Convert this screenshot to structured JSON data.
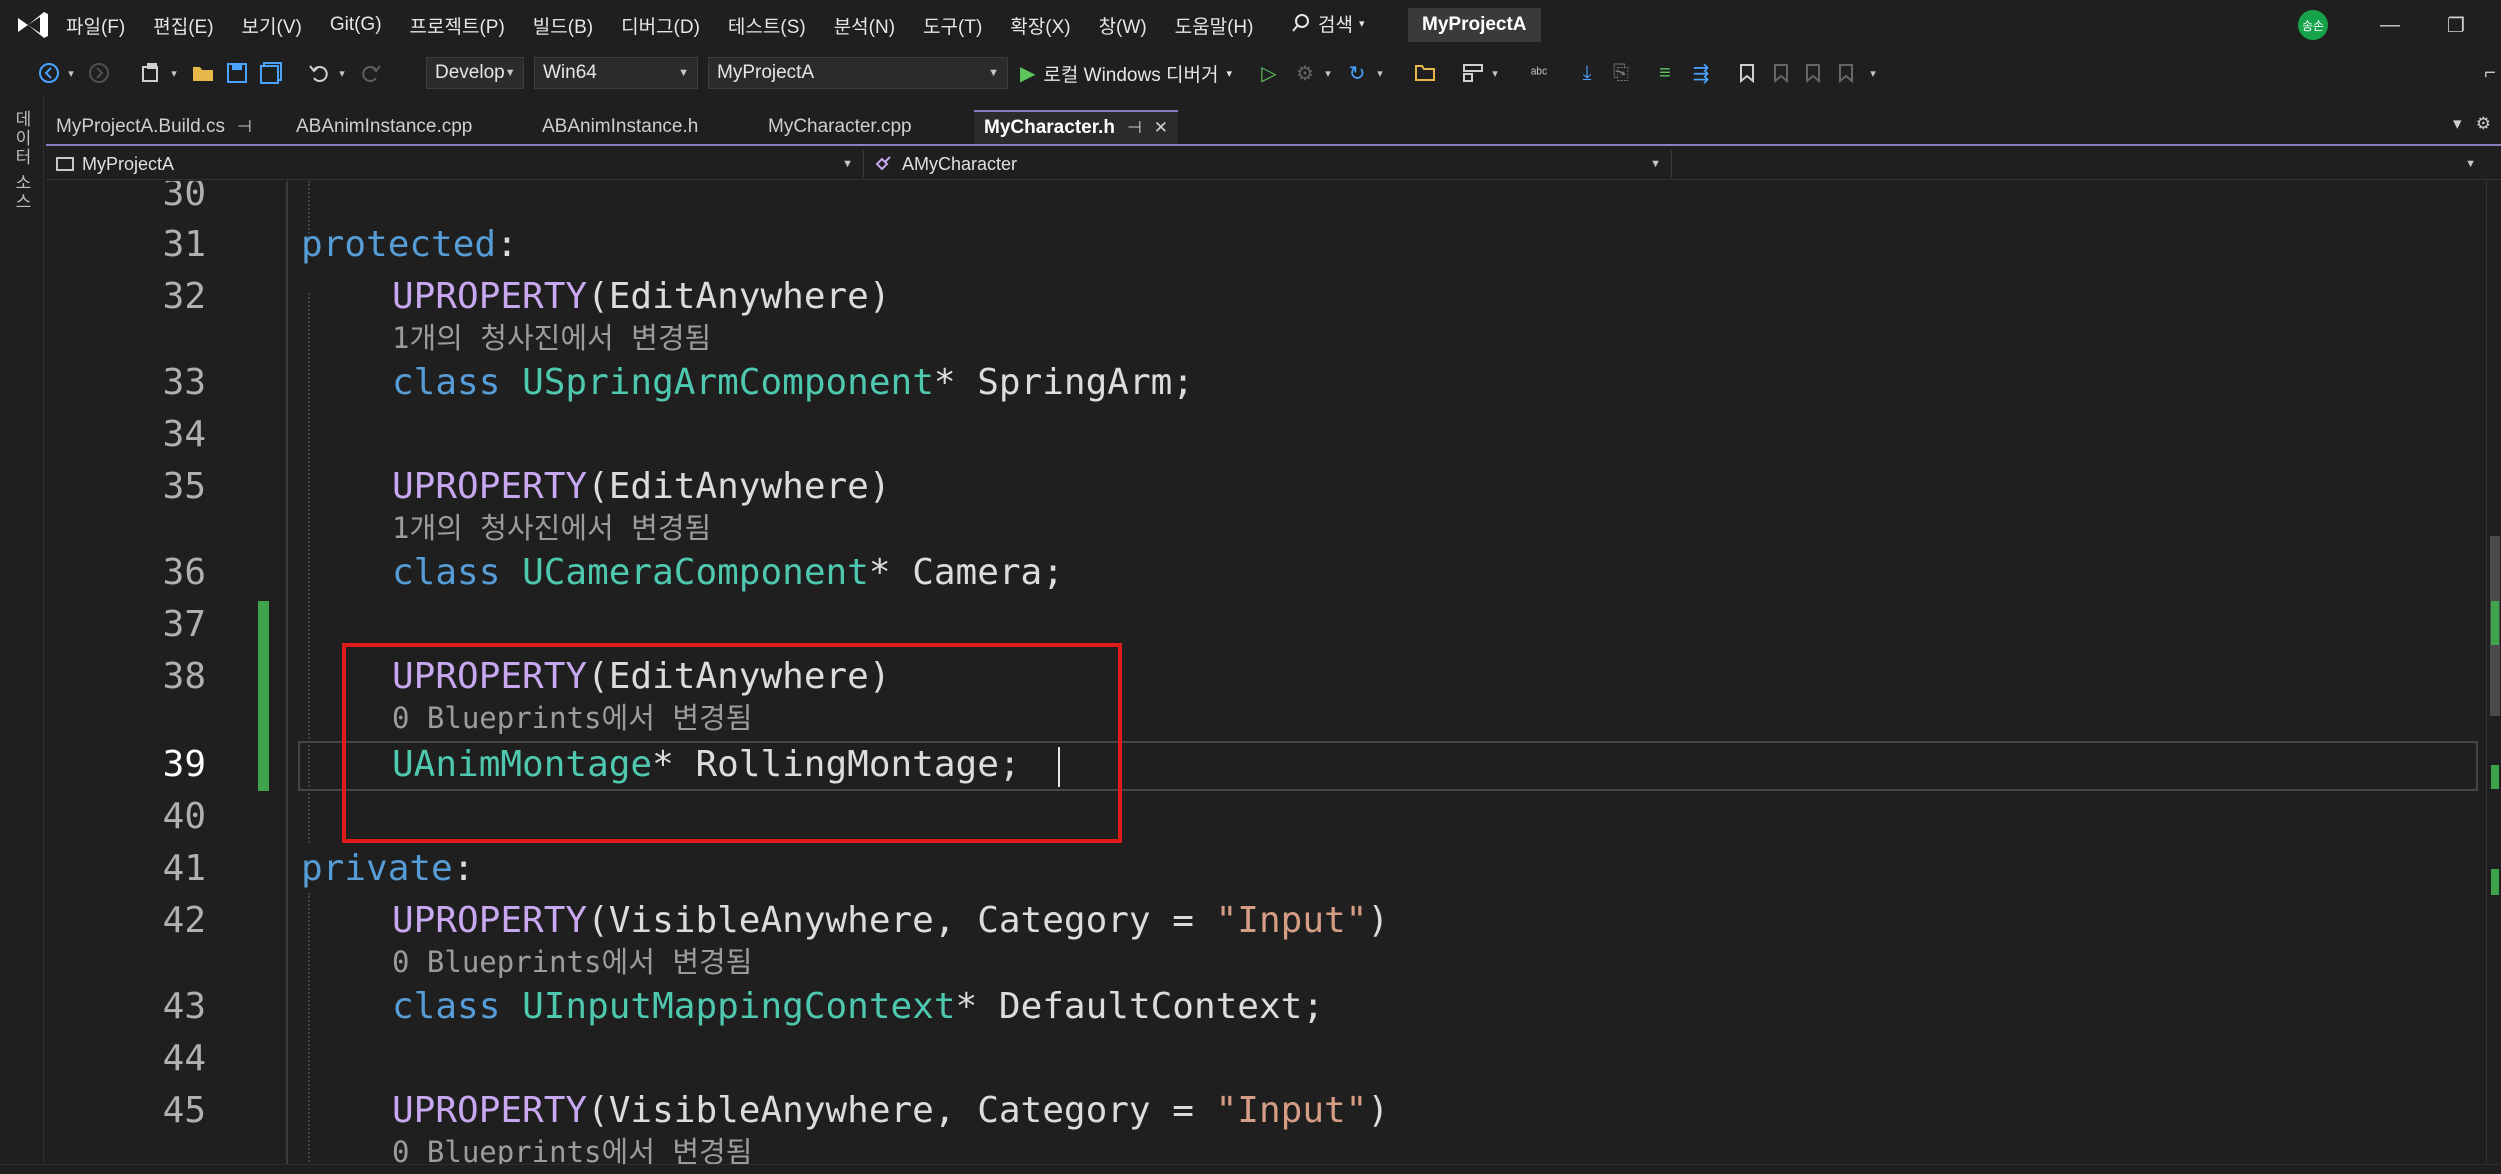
{
  "menubar": {
    "items": [
      "파일(F)",
      "편집(E)",
      "보기(V)",
      "Git(G)",
      "프로젝트(P)",
      "빌드(B)",
      "디버그(D)",
      "테스트(S)",
      "분석(N)",
      "도구(T)",
      "확장(X)",
      "창(W)",
      "도움말(H)"
    ],
    "search_label": "검색",
    "project_name": "MyProjectA",
    "avatar_text": "송손"
  },
  "toolbar": {
    "configuration": "Develop",
    "platform": "Win64",
    "startup_project": "MyProjectA",
    "run_label": "로컬 Windows 디버거"
  },
  "left_strip": {
    "label": "데이터 소스"
  },
  "tabs": [
    {
      "label": "MyProjectA.Build.cs",
      "active": false
    },
    {
      "label": "ABAnimInstance.cpp",
      "active": false
    },
    {
      "label": "ABAnimInstance.h",
      "active": false
    },
    {
      "label": "MyCharacter.cpp",
      "active": false
    },
    {
      "label": "MyCharacter.h",
      "active": true
    }
  ],
  "navbar": {
    "project_scope": "MyProjectA",
    "class_scope": "AMyCharacter"
  },
  "editor": {
    "line_numbers": [
      "30",
      "31",
      "32",
      "33",
      "34",
      "35",
      "36",
      "37",
      "38",
      "39",
      "40",
      "41",
      "42",
      "43",
      "44",
      "45"
    ],
    "current_line": "39",
    "code": {
      "l31_kw": "protected",
      "l31_colon": ":",
      "l32_macro": "UPROPERTY",
      "l32_args": "(EditAnywhere)",
      "hint_32": "1개의 청사진에서 변경됨",
      "l33_kw": "class",
      "l33_type": "USpringArmComponent",
      "l33_rest": "* SpringArm;",
      "l35_macro": "UPROPERTY",
      "l35_args": "(EditAnywhere)",
      "hint_35": "1개의 청사진에서 변경됨",
      "l36_kw": "class",
      "l36_type": "UCameraComponent",
      "l36_rest": "* Camera;",
      "l38_macro": "UPROPERTY",
      "l38_args": "(EditAnywhere)",
      "hint_38": "0 Blueprints에서 변경됨",
      "l39_type": "UAnimMontage",
      "l39_rest": "* RollingMontage;",
      "l41_kw": "private",
      "l41_colon": ":",
      "l42_macro": "UPROPERTY",
      "l42_args_a": "(VisibleAnywhere, Category = ",
      "l42_str": "\"Input\"",
      "l42_args_b": ")",
      "hint_42": "0 Blueprints에서 변경됨",
      "l43_kw": "class",
      "l43_type": "UInputMappingContext",
      "l43_rest": "* DefaultContext;",
      "l45_macro": "UPROPERTY",
      "l45_args_a": "(VisibleAnywhere, Category = ",
      "l45_str": "\"Input\"",
      "l45_args_b": ")",
      "hint_45": "0 Blueprints에서 변경됨"
    }
  },
  "colors": {
    "keyword": "#569cd6",
    "type": "#4ec9b0",
    "macro": "#c8a8f0",
    "string": "#d69d85",
    "highlight_box": "#e01b1b",
    "change_bar": "#3fa34d"
  }
}
